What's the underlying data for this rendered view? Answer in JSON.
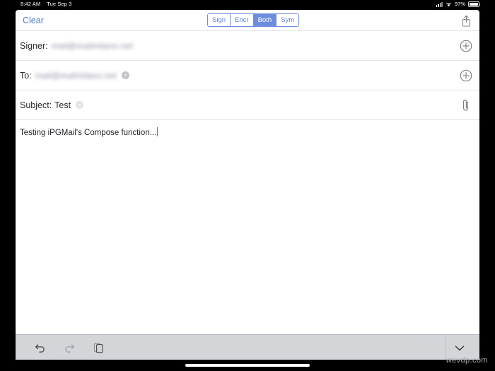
{
  "status_bar": {
    "time": "8:42 AM",
    "date": "Tue Sep 3",
    "battery_percent": "97%",
    "signal_icon": "cellular-signal-icon",
    "wifi_icon": "wifi-icon",
    "battery_icon": "battery-icon"
  },
  "toolbar": {
    "clear_label": "Clear",
    "share_icon": "share-icon",
    "segment": {
      "options": [
        {
          "label": "Sign",
          "selected": false
        },
        {
          "label": "Encr",
          "selected": false
        },
        {
          "label": "Both",
          "selected": true
        },
        {
          "label": "Sym",
          "selected": false
        }
      ]
    }
  },
  "fields": {
    "signer": {
      "label": "Signer:",
      "value": "mail@mailmilano.net",
      "action_icon": "plus-circle-icon"
    },
    "to": {
      "label": "To:",
      "value": "mail@mailmilano.net",
      "clear_glyph": "×",
      "action_icon": "plus-circle-icon"
    },
    "subject": {
      "label": "Subject:",
      "value": "Test",
      "clear_glyph": "×",
      "action_icon": "paperclip-icon"
    }
  },
  "body": {
    "text": "Testing iPGMail's Compose function..."
  },
  "accessory_bar": {
    "undo_icon": "undo-arrow-icon",
    "redo_icon": "redo-arrow-icon",
    "paste_icon": "clipboard-paste-icon",
    "dismiss_icon": "chevron-down-icon"
  },
  "watermark": {
    "text": "wevdp.com"
  },
  "colors": {
    "accent_blue": "#4a7fd4",
    "segment_blue": "#6d8ee0",
    "screen_bg": "#ffffff",
    "accessory_bg": "#d3d5d9",
    "device_frame": "#000000"
  }
}
